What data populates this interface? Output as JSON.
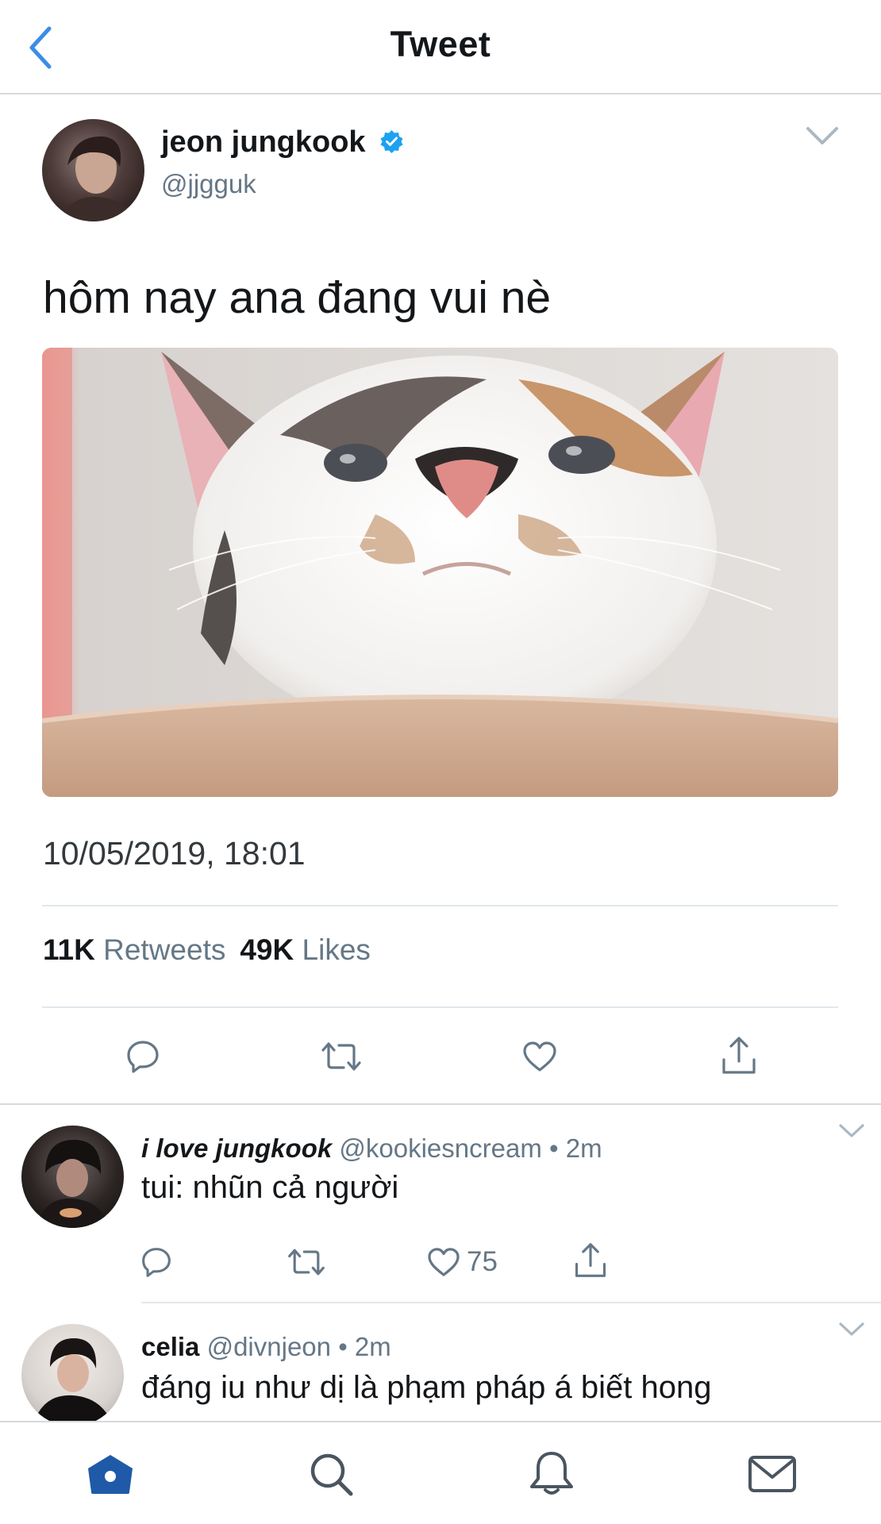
{
  "header": {
    "title": "Tweet",
    "back_icon": "chevron-left-icon"
  },
  "tweet": {
    "author": {
      "name": "jeon jungkook",
      "handle": "@jjgguk",
      "verified": true
    },
    "text": "hôm nay ana đang vui nè",
    "media": {
      "description_icon": "cat-photo"
    },
    "timestamp": "10/05/2019, 18:01",
    "stats": {
      "retweets_count": "11K",
      "retweets_label": "Retweets",
      "likes_count": "49K",
      "likes_label": "Likes"
    },
    "actions": [
      "reply-icon",
      "retweet-icon",
      "like-icon",
      "share-icon"
    ]
  },
  "replies": [
    {
      "name": "i love jungkook",
      "handle": "@kookiesncream",
      "separator": "•",
      "time": "2m",
      "text": "tui: nhũn cả người",
      "like_count": "75"
    },
    {
      "name": "celia",
      "handle": "@divnjeon",
      "separator": "•",
      "time": "2m",
      "text": "đáng iu như dị là phạm pháp á biết hong"
    }
  ],
  "tabbar": {
    "items": [
      "home-icon",
      "search-icon",
      "notifications-icon",
      "messages-icon"
    ],
    "active": "home-icon"
  },
  "colors": {
    "accent": "#1da1f2",
    "back": "#3a8ee6",
    "secondary_text": "#657786",
    "home_active": "#1f5aa8"
  }
}
